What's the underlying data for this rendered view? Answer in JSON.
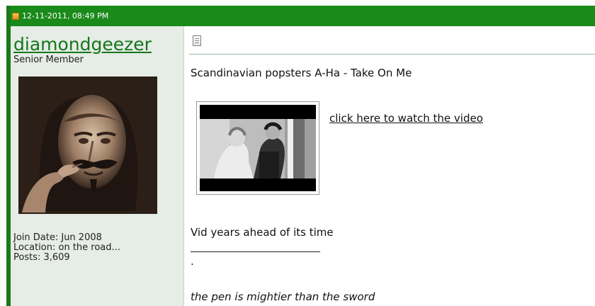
{
  "post": {
    "datetime": "12-11-2011, 08:49 PM"
  },
  "user": {
    "username": "diamondgeezer",
    "title": "Senior Member",
    "join_date": "Join Date: Jun 2008",
    "location": "Location: on the road...",
    "posts": "Posts: 3,609"
  },
  "message": {
    "title": "Scandinavian popsters A-Ha - Take On Me",
    "video_link_label": "click here to watch the video",
    "comment": "Vid years ahead of its time",
    "sig_dot": ".",
    "signature": "the pen is mightier than the sword"
  },
  "colors": {
    "header": "#1a8a1a",
    "username": "#16761a",
    "panel": "#e6ece6"
  },
  "icons": {
    "header": "post-status-icon",
    "message": "message-doc-icon"
  }
}
